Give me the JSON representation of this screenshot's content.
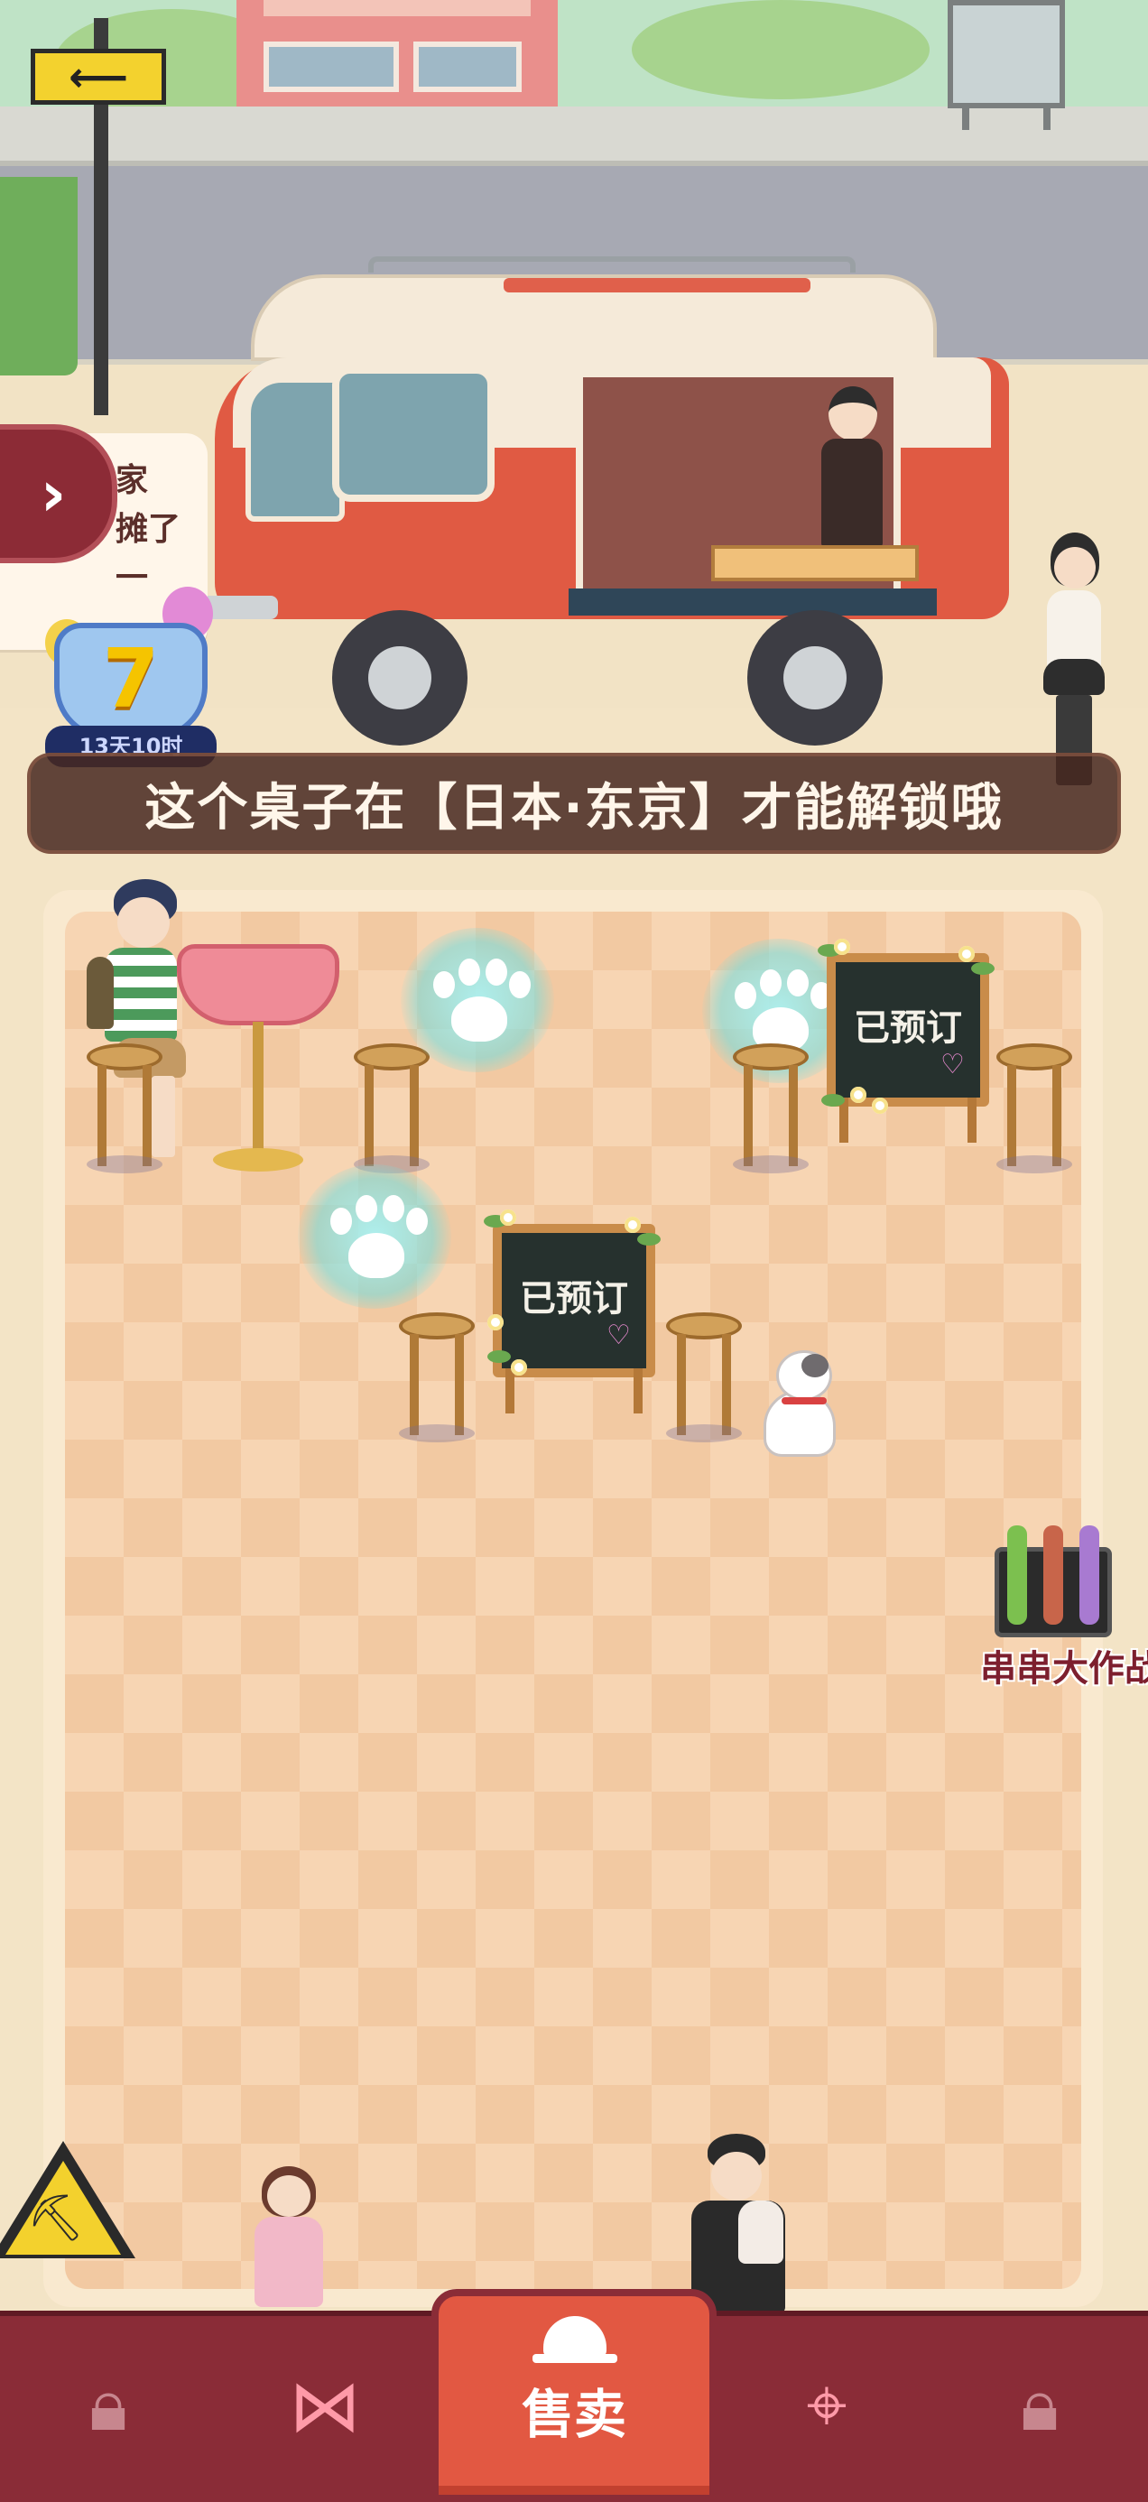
{
  "side_panel": {
    "expand_icon": "chevron-right-icon",
    "text_line1": "家",
    "text_line2": "摊了一"
  },
  "level_badge": {
    "level": "7",
    "timer": "13天10时"
  },
  "notice": {
    "text": "这个桌子在【日本·东京】才能解锁哦"
  },
  "tables": [
    {
      "status": "已预订"
    },
    {
      "status": "已预订"
    }
  ],
  "event": {
    "label": "串串大作战",
    "icon": "skewer-grill-icon"
  },
  "bottom_nav": {
    "items": [
      {
        "icon": "lock-icon",
        "state": "locked"
      },
      {
        "icon": "bow-icon",
        "state": "unlocked"
      },
      {
        "icon": "bell-icon",
        "label": "售卖",
        "state": "active"
      },
      {
        "icon": "map-pin-icon",
        "state": "unlocked"
      },
      {
        "icon": "lock-icon",
        "state": "locked"
      }
    ]
  },
  "colors": {
    "nav_bg": "#8a2c37",
    "sell_button": "#e25842",
    "notice_bg": "#46281f",
    "floor_light": "#f7d5b3",
    "floor_dark": "#f2c9a2"
  }
}
